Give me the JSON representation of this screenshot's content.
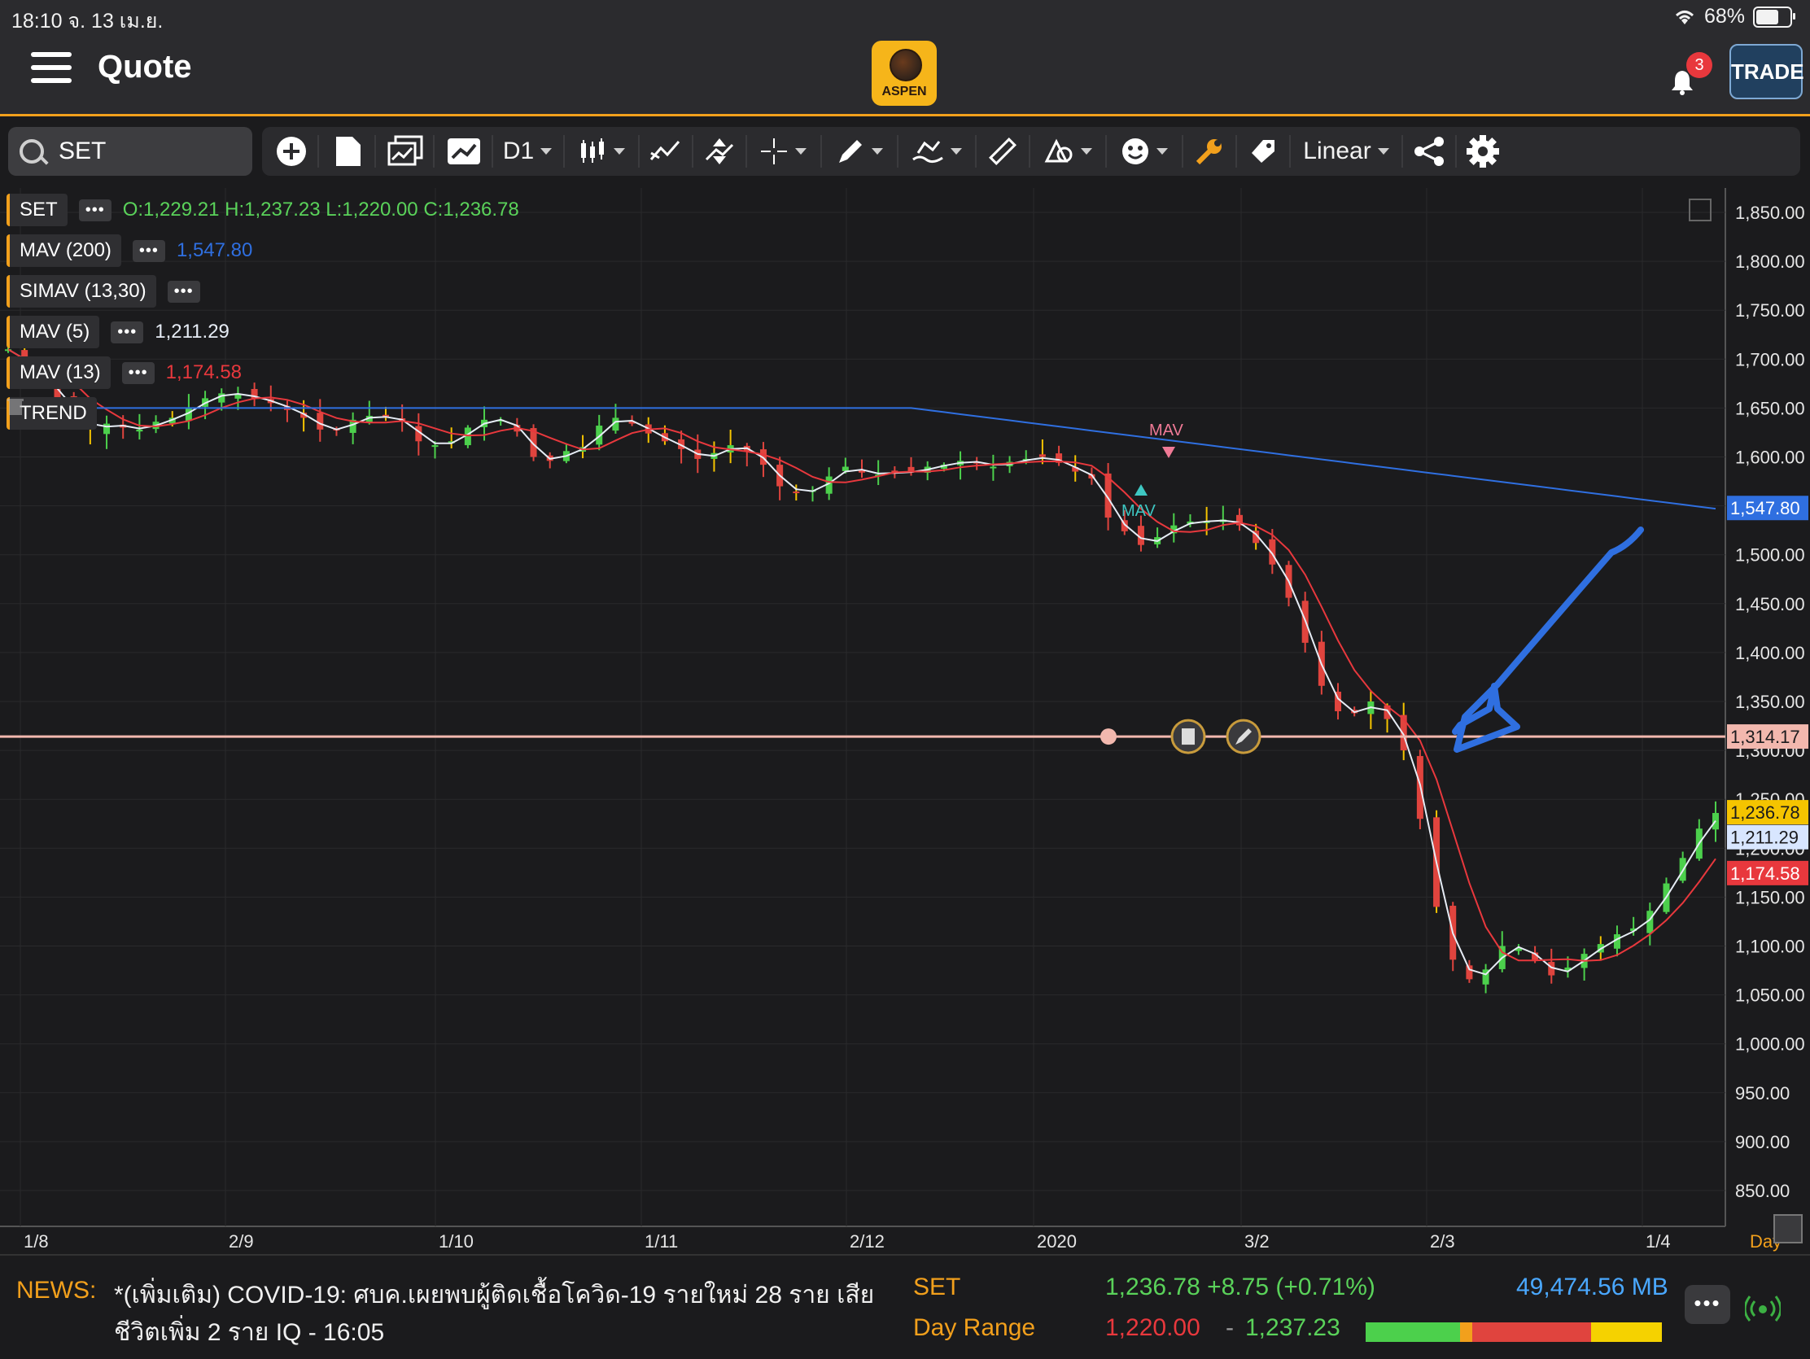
{
  "status_bar": {
    "time_date": "18:10   จ. 13 เม.ย.",
    "battery": "68%",
    "battery_level": 0.68
  },
  "header": {
    "title": "Quote",
    "logo_text": "ASPEN",
    "notification_count": "3",
    "trade_label": "TRADE"
  },
  "toolbar": {
    "search_value": "SET",
    "interval": "D1",
    "scale": "Linear"
  },
  "legend": {
    "set_label": "SET",
    "ohlc": "O:1,229.21  H:1,237.23  L:1,220.00  C:1,236.78",
    "mav200_label": "MAV (200)",
    "mav200_value": "1,547.80",
    "simav_label": "SIMAV (13,30)",
    "mav5_label": "MAV (5)",
    "mav5_value": "1,211.29",
    "mav13_label": "MAV (13)",
    "mav13_value": "1,174.58",
    "trend_label": "TREND",
    "signal_mav": "MAV"
  },
  "chart_data": {
    "type": "candlestick",
    "y_ticks": [
      "1,850.00",
      "1,800.00",
      "1,750.00",
      "1,700.00",
      "1,650.00",
      "1,600.00",
      "1,550.00",
      "1,500.00",
      "1,450.00",
      "1,400.00",
      "1,350.00",
      "1,300.00",
      "1,250.00",
      "1,200.00",
      "1,150.00",
      "1,100.00",
      "1,050.00",
      "1,000.00",
      "950.00",
      "900.00",
      "850.00"
    ],
    "x_ticks": [
      "1/8",
      "2/9",
      "1/10",
      "1/11",
      "2/12",
      "2020",
      "3/2",
      "2/3",
      "1/4"
    ],
    "x_unit_label": "Day",
    "ylim": [
      840,
      1860
    ],
    "horizontal_line": 1314.17,
    "price_labels": [
      {
        "value": 1547.8,
        "text": "1,547.80",
        "color": "#2f6fe0"
      },
      {
        "value": 1314.17,
        "text": "1,314.17",
        "color": "#f2b8ae"
      },
      {
        "value": 1236.78,
        "text": "1,236.78",
        "color": "#f5c400"
      },
      {
        "value": 1211.29,
        "text": "1,211.29",
        "color": "#d8e6ff"
      },
      {
        "value": 1174.58,
        "text": "1,174.58",
        "color": "#e8383d"
      }
    ],
    "close_path": [
      1710,
      1690,
      1680,
      1660,
      1640,
      1628,
      1634,
      1630,
      1628,
      1636,
      1640,
      1650,
      1660,
      1665,
      1664,
      1660,
      1655,
      1648,
      1640,
      1628,
      1628,
      1638,
      1642,
      1640,
      1636,
      1616,
      1612,
      1616,
      1630,
      1638,
      1638,
      1626,
      1600,
      1596,
      1606,
      1610,
      1632,
      1640,
      1634,
      1624,
      1616,
      1608,
      1598,
      1604,
      1612,
      1606,
      1592,
      1570,
      1564,
      1566,
      1580,
      1590,
      1584,
      1582,
      1585,
      1584,
      1590,
      1592,
      1596,
      1594,
      1590,
      1595,
      1598,
      1600,
      1594,
      1585,
      1578,
      1538,
      1524,
      1510,
      1518,
      1530,
      1534,
      1534,
      1536,
      1530,
      1512,
      1490,
      1456,
      1410,
      1366,
      1340,
      1338,
      1350,
      1332,
      1300,
      1230,
      1140,
      1086,
      1066,
      1076,
      1100,
      1098,
      1086,
      1070,
      1078,
      1092,
      1102,
      1112,
      1118,
      1136,
      1164,
      1190,
      1220,
      1236
    ]
  },
  "news": {
    "label": "NEWS:",
    "text": "*(เพิ่มเติม) COVID-19: ศบค.เผยพบผู้ติดเชื้อโควิด-19 รายใหม่ 28 ราย เสียชีวิตเพิ่ม 2 ราย  IQ - 16:05"
  },
  "quote": {
    "symbol": "SET",
    "last": "1,236.78 +8.75 (+0.71%)",
    "volume": "49,474.56 MB",
    "range_label": "Day Range",
    "range_low": "1,220.00",
    "range_high": "1,237.23",
    "range_dash": "-"
  }
}
